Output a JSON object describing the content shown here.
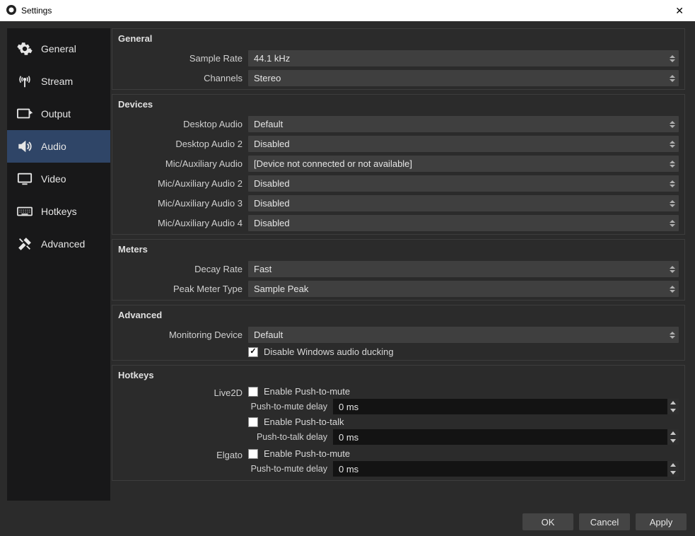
{
  "window": {
    "title": "Settings"
  },
  "sidebar": {
    "items": [
      {
        "label": "General"
      },
      {
        "label": "Stream"
      },
      {
        "label": "Output"
      },
      {
        "label": "Audio"
      },
      {
        "label": "Video"
      },
      {
        "label": "Hotkeys"
      },
      {
        "label": "Advanced"
      }
    ]
  },
  "general": {
    "title": "General",
    "sample_rate_label": "Sample Rate",
    "sample_rate_value": "44.1 kHz",
    "channels_label": "Channels",
    "channels_value": "Stereo"
  },
  "devices": {
    "title": "Devices",
    "desktop_audio_label": "Desktop Audio",
    "desktop_audio_value": "Default",
    "desktop_audio2_label": "Desktop Audio 2",
    "desktop_audio2_value": "Disabled",
    "mic1_label": "Mic/Auxiliary Audio",
    "mic1_value": "[Device not connected or not available]",
    "mic2_label": "Mic/Auxiliary Audio 2",
    "mic2_value": "Disabled",
    "mic3_label": "Mic/Auxiliary Audio 3",
    "mic3_value": "Disabled",
    "mic4_label": "Mic/Auxiliary Audio 4",
    "mic4_value": "Disabled"
  },
  "meters": {
    "title": "Meters",
    "decay_label": "Decay Rate",
    "decay_value": "Fast",
    "peak_label": "Peak Meter Type",
    "peak_value": "Sample Peak"
  },
  "advanced": {
    "title": "Advanced",
    "monitoring_label": "Monitoring Device",
    "monitoring_value": "Default",
    "ducking_label": "Disable Windows audio ducking"
  },
  "hotkeys": {
    "title": "Hotkeys",
    "devices": [
      {
        "name": "Live2D",
        "enable_ptm_label": "Enable Push-to-mute",
        "ptm_delay_label": "Push-to-mute delay",
        "ptm_delay_value": "0 ms",
        "enable_ptt_label": "Enable Push-to-talk",
        "ptt_delay_label": "Push-to-talk delay",
        "ptt_delay_value": "0 ms"
      },
      {
        "name": "Elgato",
        "enable_ptm_label": "Enable Push-to-mute",
        "ptm_delay_label": "Push-to-mute delay",
        "ptm_delay_value": "0 ms"
      }
    ]
  },
  "footer": {
    "ok": "OK",
    "cancel": "Cancel",
    "apply": "Apply"
  }
}
